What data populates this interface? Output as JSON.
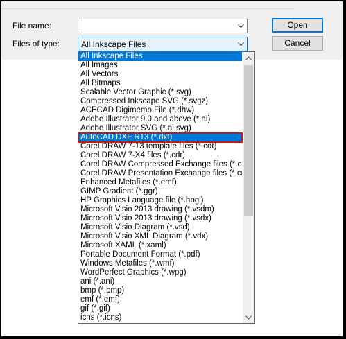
{
  "form": {
    "file_name_label": "File name:",
    "file_name_value": "",
    "files_of_type_label": "Files of type:",
    "files_of_type_value": "All Inkscape Files"
  },
  "buttons": {
    "open": "Open",
    "cancel": "Cancel"
  },
  "dropdown": {
    "items": [
      "All Inkscape Files",
      "All Images",
      "All Vectors",
      "All Bitmaps",
      "Scalable Vector Graphic (*.svg)",
      "Compressed Inkscape SVG (*.svgz)",
      "ACECAD Digimemo File (*.dhw)",
      "Adobe Illustrator 9.0 and above (*.ai)",
      "Adobe Illustrator SVG (*.ai.svg)",
      "AutoCAD DXF R13 (*.dxf)",
      "Corel DRAW 7-13 template files (*.cdt)",
      "Corel DRAW 7-X4 files (*.cdr)",
      "Corel DRAW Compressed Exchange files (*.ccx)",
      "Corel DRAW Presentation Exchange files (*.cmx)",
      "Enhanced Metafiles (*.emf)",
      "GIMP Gradient (*.ggr)",
      "HP Graphics Language file (*.hpgl)",
      "Microsoft Visio 2013 drawing (*.vsdm)",
      "Microsoft Visio 2013 drawing (*.vsdx)",
      "Microsoft Visio Diagram (*.vsd)",
      "Microsoft Visio XML Diagram (*.vdx)",
      "Microsoft XAML (*.xaml)",
      "Portable Document Format (*.pdf)",
      "Windows Metafiles (*.wmf)",
      "WordPerfect Graphics (*.wpg)",
      "ani (*.ani)",
      "bmp (*.bmp)",
      "emf (*.emf)",
      "gif (*.gif)",
      "icns (*.icns)"
    ],
    "highlighted_item": "AutoCAD DXF R13 (*.dxf)"
  },
  "icons": {
    "combo_arrow": "chevron-down-icon",
    "scroll_up": "scroll-up-arrow-icon",
    "scroll_down": "scroll-down-arrow-icon"
  },
  "colors": {
    "highlight": "#0078d7",
    "annotation_box": "#c4161c"
  }
}
